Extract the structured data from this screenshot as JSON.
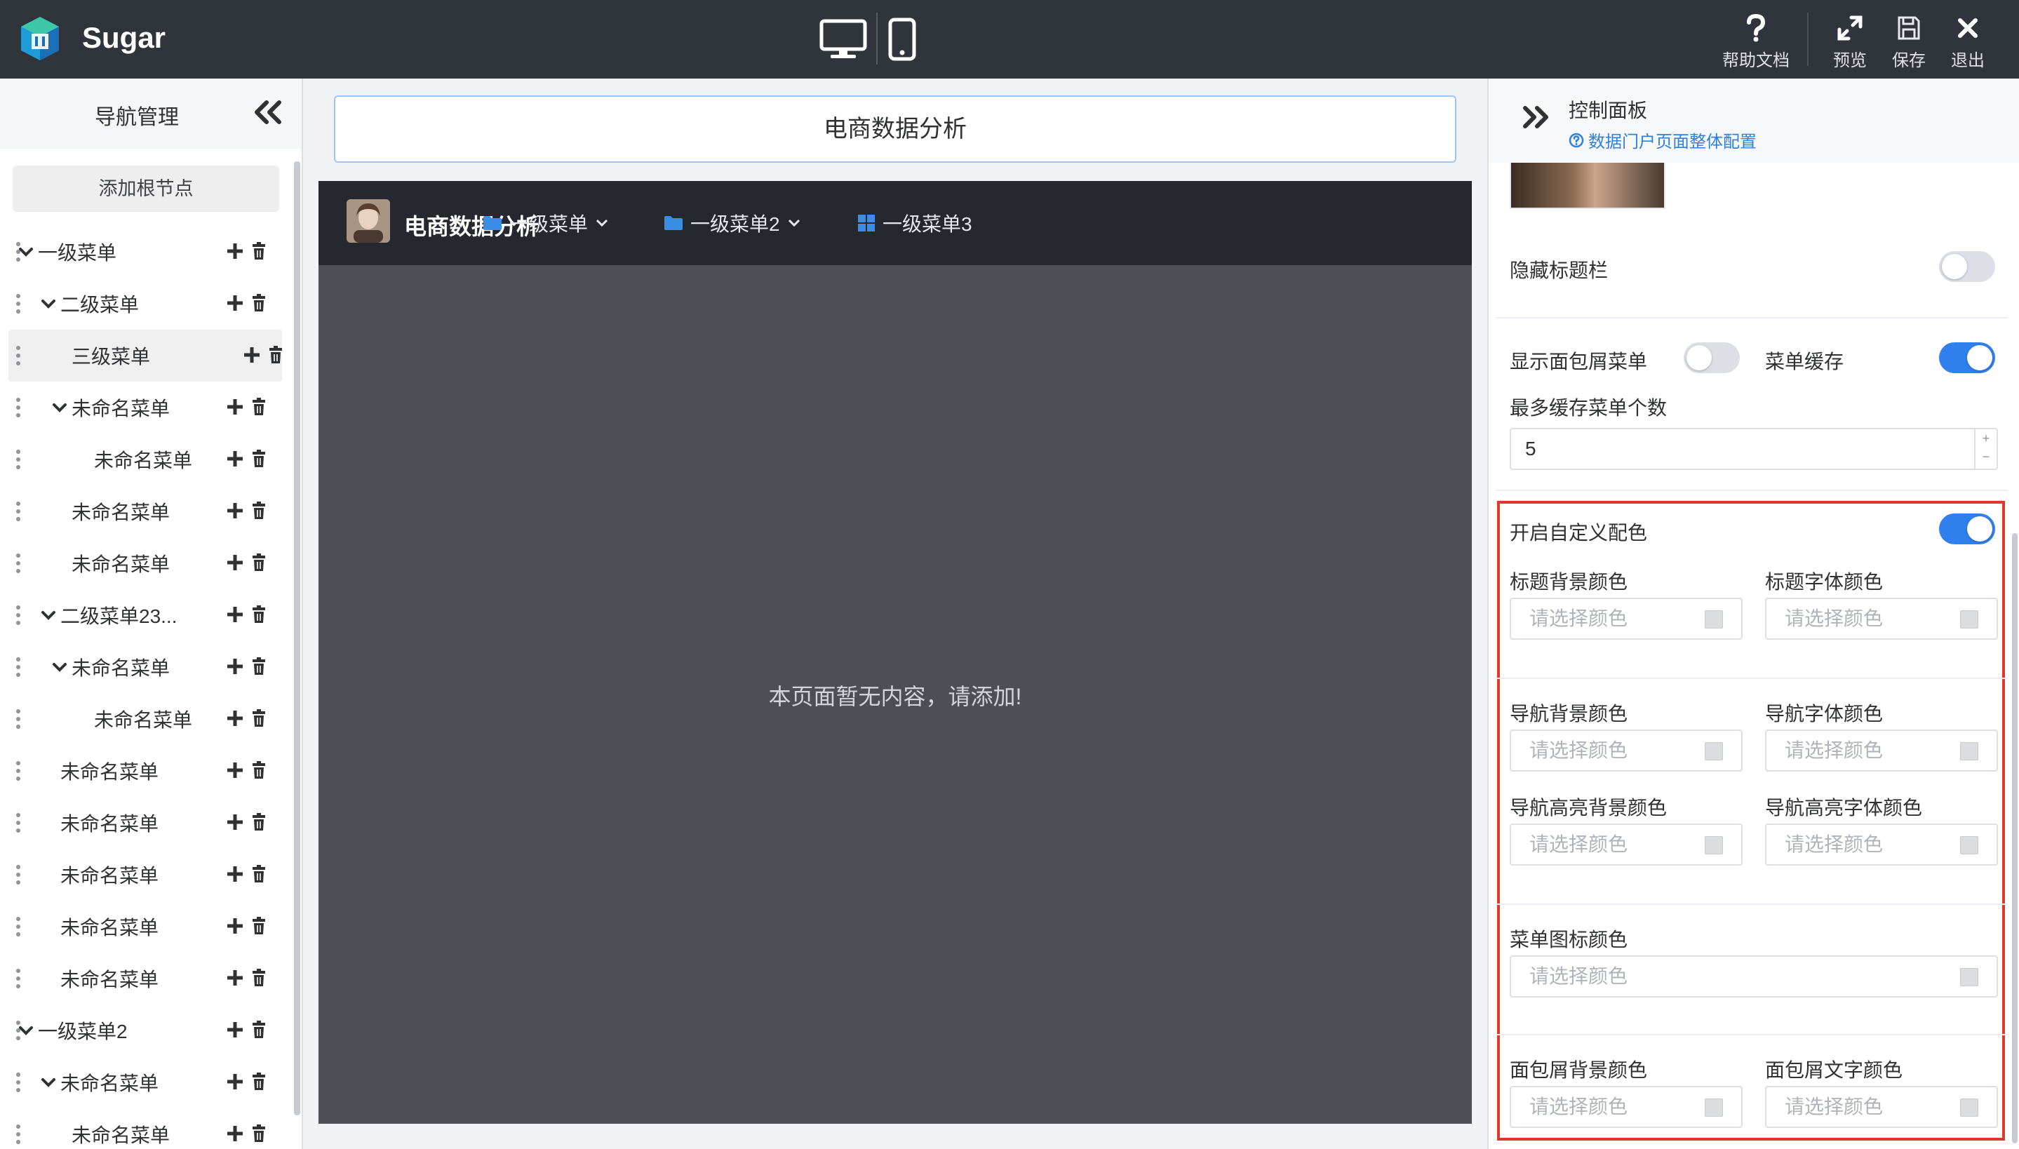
{
  "app": {
    "brand": "Sugar"
  },
  "toolbar": {
    "help_label": "帮助文档",
    "preview_label": "预览",
    "save_label": "保存",
    "exit_label": "退出"
  },
  "nav_panel": {
    "title": "导航管理",
    "add_root_label": "添加根节点",
    "items": [
      {
        "label": "一级菜单",
        "depth": 0,
        "expanded": true
      },
      {
        "label": "二级菜单",
        "depth": 1,
        "expanded": true
      },
      {
        "label": "三级菜单",
        "depth": 2,
        "expanded": false,
        "selected": true
      },
      {
        "label": "未命名菜单",
        "depth": 2,
        "expanded": true
      },
      {
        "label": "未命名菜单",
        "depth": 3,
        "expanded": false
      },
      {
        "label": "未命名菜单",
        "depth": 2,
        "expanded": false
      },
      {
        "label": "未命名菜单",
        "depth": 2,
        "expanded": false
      },
      {
        "label": "二级菜单23...",
        "depth": 1,
        "expanded": true
      },
      {
        "label": "未命名菜单",
        "depth": 2,
        "expanded": true
      },
      {
        "label": "未命名菜单",
        "depth": 3,
        "expanded": false
      },
      {
        "label": "未命名菜单",
        "depth": 1,
        "expanded": false
      },
      {
        "label": "未命名菜单",
        "depth": 1,
        "expanded": false
      },
      {
        "label": "未命名菜单",
        "depth": 1,
        "expanded": false
      },
      {
        "label": "未命名菜单",
        "depth": 1,
        "expanded": false
      },
      {
        "label": "未命名菜单",
        "depth": 1,
        "expanded": false
      },
      {
        "label": "一级菜单2",
        "depth": 0,
        "expanded": true
      },
      {
        "label": "未命名菜单",
        "depth": 1,
        "expanded": true
      },
      {
        "label": "未命名菜单",
        "depth": 2,
        "expanded": false
      }
    ]
  },
  "canvas": {
    "title_value": "电商数据分析",
    "nav_title": "电商数据分析",
    "menus": [
      {
        "label": "一级菜单",
        "icon": "folder-icon",
        "dropdown": true
      },
      {
        "label": "一级菜单2",
        "icon": "folder-icon",
        "dropdown": true
      },
      {
        "label": "一级菜单3",
        "icon": "grid-icon",
        "dropdown": false
      }
    ],
    "empty_text": "本页面暂无内容，请添加!"
  },
  "control_panel": {
    "title": "控制面板",
    "config_link": "数据门户页面整体配置",
    "hide_titlebar_label": "隐藏标题栏",
    "hide_titlebar_on": false,
    "show_breadcrumb_label": "显示面包屑菜单",
    "show_breadcrumb_on": false,
    "menu_cache_label": "菜单缓存",
    "menu_cache_on": true,
    "max_cache_label": "最多缓存菜单个数",
    "max_cache_value": "5",
    "custom_color_label": "开启自定义配色",
    "custom_color_on": true,
    "color_placeholder": "请选择颜色",
    "title_bg_label": "标题背景颜色",
    "title_font_label": "标题字体颜色",
    "nav_bg_label": "导航背景颜色",
    "nav_font_label": "导航字体颜色",
    "nav_hl_bg_label": "导航高亮背景颜色",
    "nav_hl_font_label": "导航高亮字体颜色",
    "menu_icon_label": "菜单图标颜色",
    "breadcrumb_bg_label": "面包屑背景颜色",
    "breadcrumb_text_label": "面包屑文字颜色"
  },
  "colors": {
    "topbar_bg": "#30343b",
    "canvas_bg": "#4c4f56",
    "canvas_nav_bg": "#25282e",
    "accent": "#2f80ed",
    "highlight_border": "#e0382d"
  }
}
